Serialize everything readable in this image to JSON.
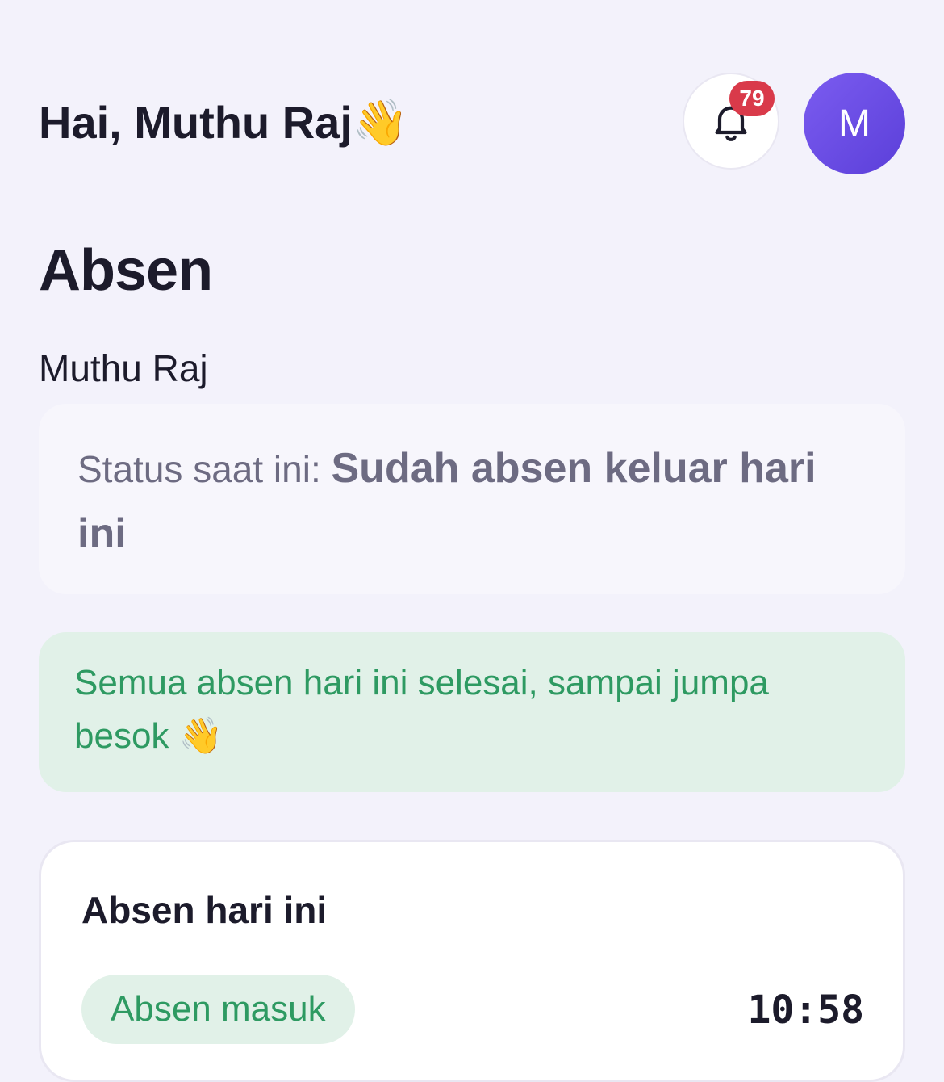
{
  "header": {
    "greeting": "Hai, Muthu Raj👋",
    "notification_count": "79",
    "avatar_initial": "M"
  },
  "page": {
    "title": "Absen",
    "user_name": "Muthu Raj"
  },
  "status": {
    "label": "Status saat ini: ",
    "value": "Sudah absen keluar hari ini"
  },
  "success_message": "Semua absen hari ini selesai, sampai jumpa besok 👋",
  "today": {
    "title": "Absen hari ini",
    "entries": [
      {
        "label": "Absen masuk",
        "time": "10:58"
      }
    ]
  },
  "colors": {
    "background": "#f3f2fb",
    "accent": "#6a4ce6",
    "badge": "#d93a4a",
    "success": "#2e9a62",
    "success_bg": "#e1f1e8"
  },
  "icons": {
    "notification": "bell-icon"
  }
}
